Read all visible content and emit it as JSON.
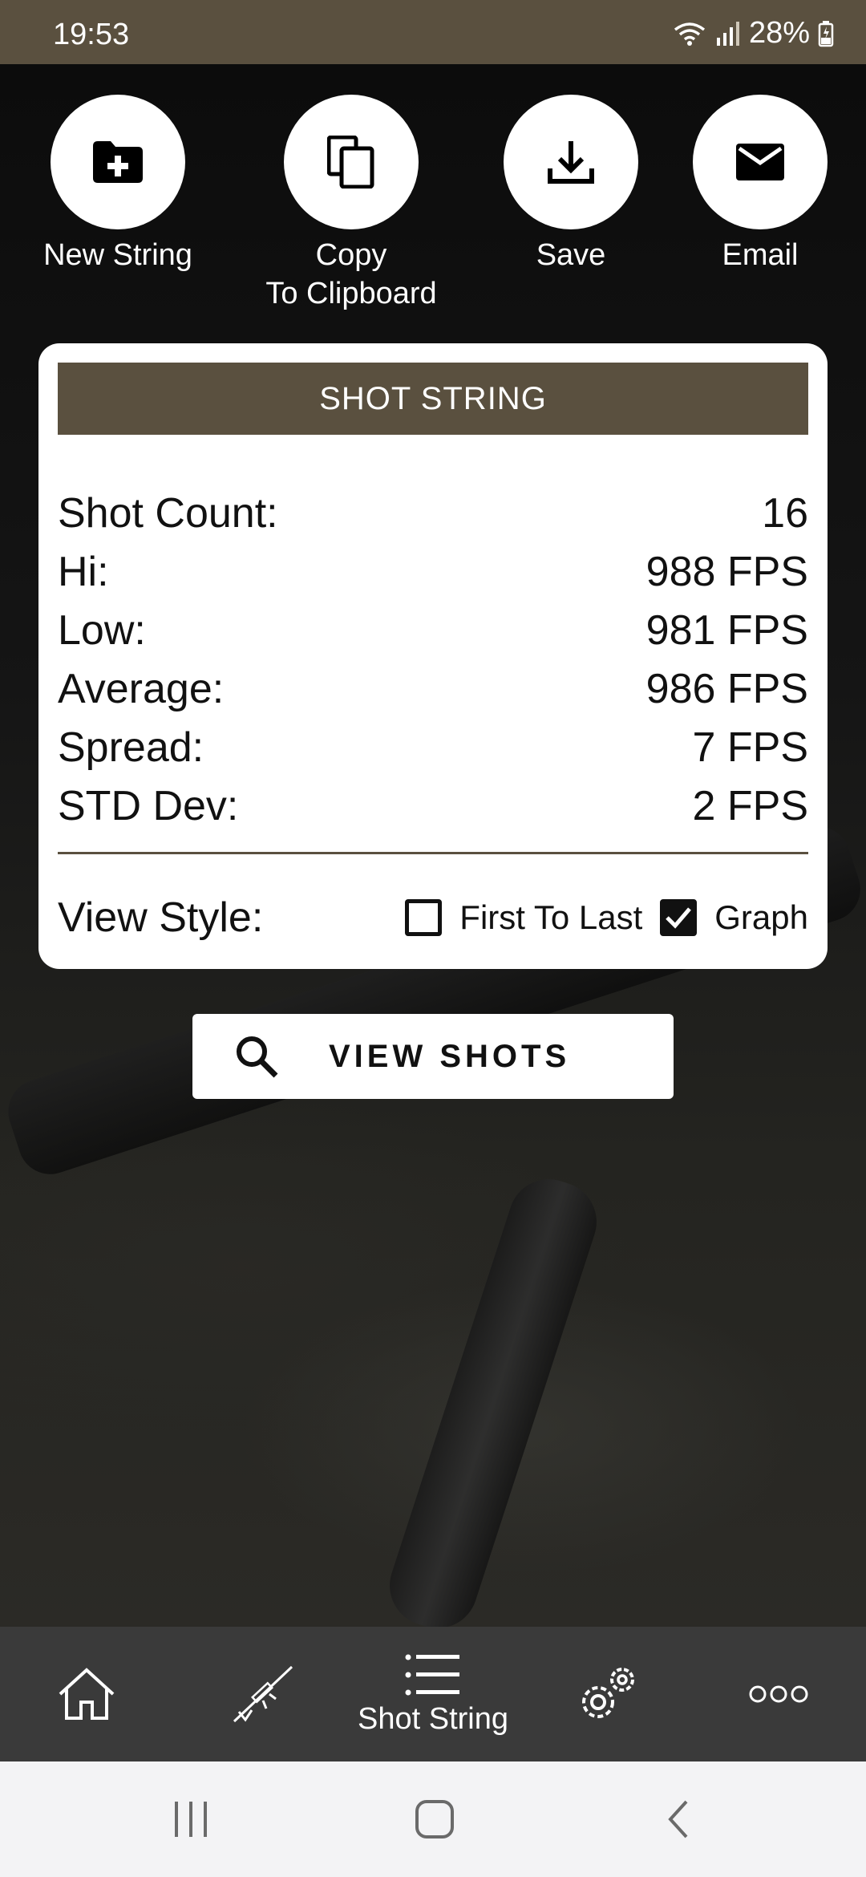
{
  "status_bar": {
    "time": "19:53",
    "battery": "28%"
  },
  "actions": [
    {
      "label": "New String",
      "icon": "folder-plus-icon"
    },
    {
      "label": "Copy\nTo Clipboard",
      "icon": "copy-icon"
    },
    {
      "label": "Save",
      "icon": "download-icon"
    },
    {
      "label": "Email",
      "icon": "mail-icon"
    }
  ],
  "card": {
    "title": "SHOT STRING",
    "stats": [
      {
        "label": "Shot Count:",
        "value": "16"
      },
      {
        "label": "Hi:",
        "value": "988 FPS"
      },
      {
        "label": "Low:",
        "value": "981 FPS"
      },
      {
        "label": "Average:",
        "value": "986 FPS"
      },
      {
        "label": "Spread:",
        "value": "7 FPS"
      },
      {
        "label": "STD Dev:",
        "value": "2 FPS"
      }
    ],
    "view_style": {
      "label": "View Style:",
      "options": [
        {
          "label": "First To Last",
          "checked": false
        },
        {
          "label": "Graph",
          "checked": true
        }
      ]
    }
  },
  "view_shots_button": {
    "label": "VIEW SHOTS",
    "icon": "search-icon"
  },
  "bottom_nav": {
    "items": [
      {
        "icon": "home-icon"
      },
      {
        "icon": "rifle-icon"
      },
      {
        "icon": "list-icon",
        "label": "Shot String",
        "active": true
      },
      {
        "icon": "gears-icon"
      },
      {
        "icon": "more-icon"
      }
    ]
  },
  "colors": {
    "brand": "#5a503f",
    "nav_bg": "#3a3a3a"
  }
}
